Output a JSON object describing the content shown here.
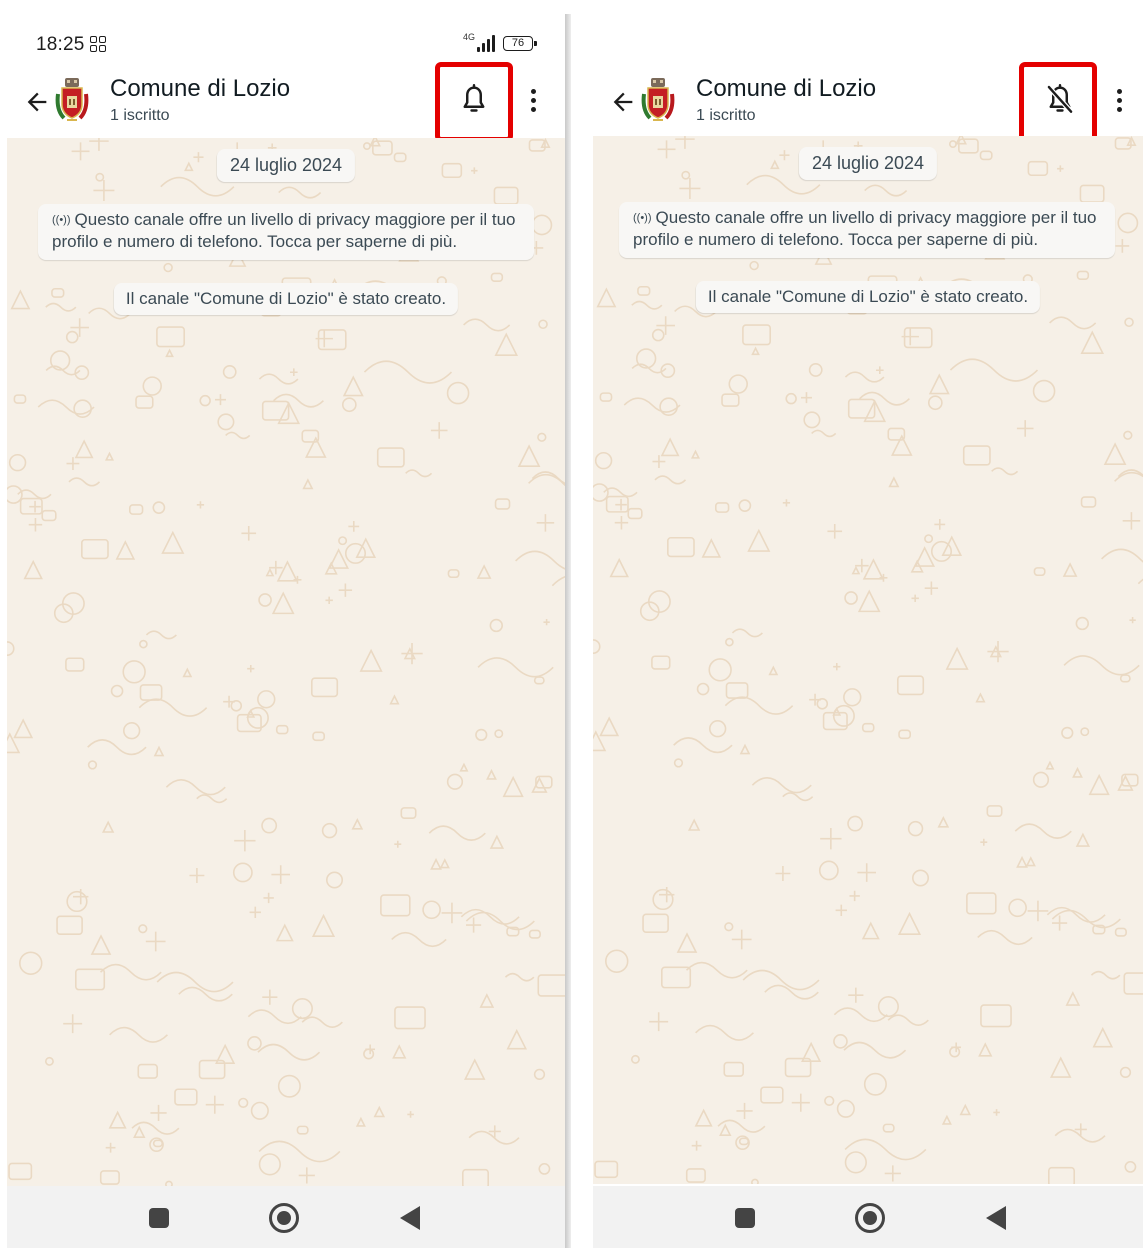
{
  "screens": [
    {
      "status": {
        "time": "18:25",
        "network": "4G",
        "battery": "76"
      },
      "header": {
        "title": "Comune di Lozio",
        "subtitle": "1 iscritto",
        "bell_icon": "bell-icon",
        "bell_state": "on"
      },
      "chat": {
        "date_chip": "24 luglio 2024",
        "privacy_notice": "Questo canale offre un livello di privacy maggiore per il tuo profilo e numero di telefono. Tocca per saperne di più.",
        "system_message": "Il canale \"Comune di Lozio\" è stato creato."
      }
    },
    {
      "header": {
        "title": "Comune di Lozio",
        "subtitle": "1 iscritto",
        "bell_icon": "bell-off-icon",
        "bell_state": "muted"
      },
      "chat": {
        "date_chip": "24 luglio 2024",
        "privacy_notice": "Questo canale offre un livello di privacy maggiore per il tuo profilo e numero di telefono. Tocca per saperne di più.",
        "system_message": "Il canale \"Comune di Lozio\" è stato creato."
      }
    }
  ],
  "colors": {
    "highlight": "#e40000",
    "chat_background": "#f6f0e7",
    "doodle": "#ead9c3",
    "bubble": "#f8f7f5",
    "text_primary": "#111b21",
    "text_secondary": "#3b4a54"
  }
}
